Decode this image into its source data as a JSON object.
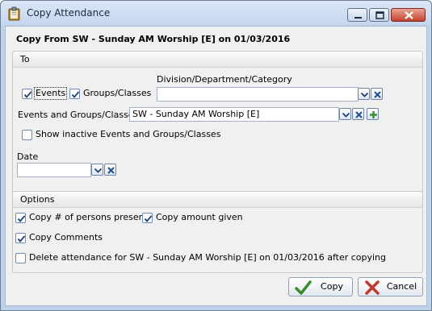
{
  "window": {
    "title": "Copy Attendance"
  },
  "header": {
    "text": "Copy From SW - Sunday AM Worship [E] on 01/03/2016"
  },
  "to_section": {
    "title": "To",
    "events_label": "Events",
    "events_checked": true,
    "groups_label": "Groups/Classes",
    "groups_checked": true,
    "division_label": "Division/Department/Category",
    "division_value": "",
    "events_groups_label": "Events and Groups/Classes",
    "events_groups_value": "SW - Sunday AM Worship [E]",
    "show_inactive_label": "Show inactive Events and Groups/Classes",
    "show_inactive_checked": false,
    "date_label": "Date",
    "date_value": ""
  },
  "options_section": {
    "title": "Options",
    "copy_persons_label": "Copy # of persons present",
    "copy_persons_checked": true,
    "copy_amount_label": "Copy amount given",
    "copy_amount_checked": true,
    "copy_comments_label": "Copy Comments",
    "copy_comments_checked": true,
    "delete_label": "Delete attendance for SW - Sunday AM Worship [E] on 01/03/2016  after copying",
    "delete_checked": false
  },
  "buttons": {
    "copy_label": "Copy",
    "cancel_label": "Cancel"
  },
  "icons": {
    "app": "clipboard-icon",
    "minimize": "minimize-icon",
    "maximize": "maximize-icon",
    "close": "close-icon",
    "dropdown": "chevron-down-icon",
    "clear": "clear-x-icon",
    "add": "plus-icon",
    "copy": "checkmark-icon",
    "cancel": "x-icon"
  },
  "colors": {
    "check": "#1f3f7a",
    "accent_x": "#c0392b",
    "copy_check": "#3a8b2f",
    "add_plus": "#3a8b2f"
  }
}
